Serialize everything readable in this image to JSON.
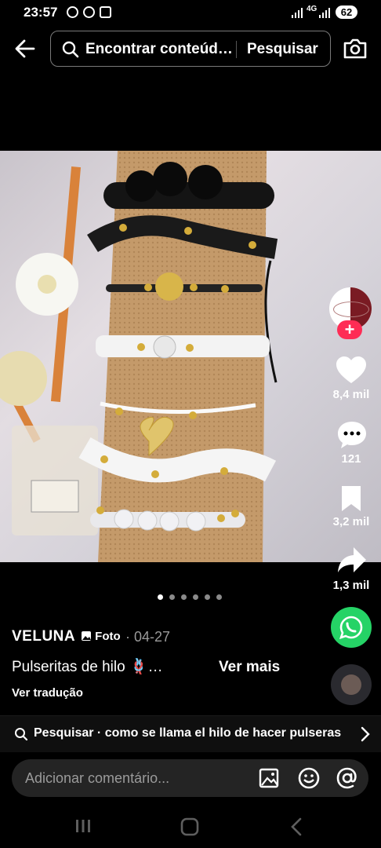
{
  "status": {
    "time": "23:57",
    "network": "4G",
    "battery": "62"
  },
  "search": {
    "text": "Encontrar conteúd…",
    "button": "Pesquisar"
  },
  "rail": {
    "likes": "8,4 mil",
    "comments": "121",
    "saves": "3,2 mil",
    "shares": "1,3 mil"
  },
  "post": {
    "author": "VELUNA",
    "badge": "Foto",
    "date": "· 04-27",
    "caption": "Pulseritas de hilo 🪢…",
    "more": "Ver mais",
    "translate": "Ver tradução"
  },
  "related_search": {
    "text": "Pesquisar · como se llama el hilo de hacer pulseras"
  },
  "comment": {
    "placeholder": "Adicionar comentário..."
  },
  "carousel": {
    "total": 6,
    "active": 0
  },
  "colors": {
    "background": "#000000",
    "like": "#ffffff",
    "follow": "#fe2c55",
    "whatsapp": "#25d366"
  }
}
